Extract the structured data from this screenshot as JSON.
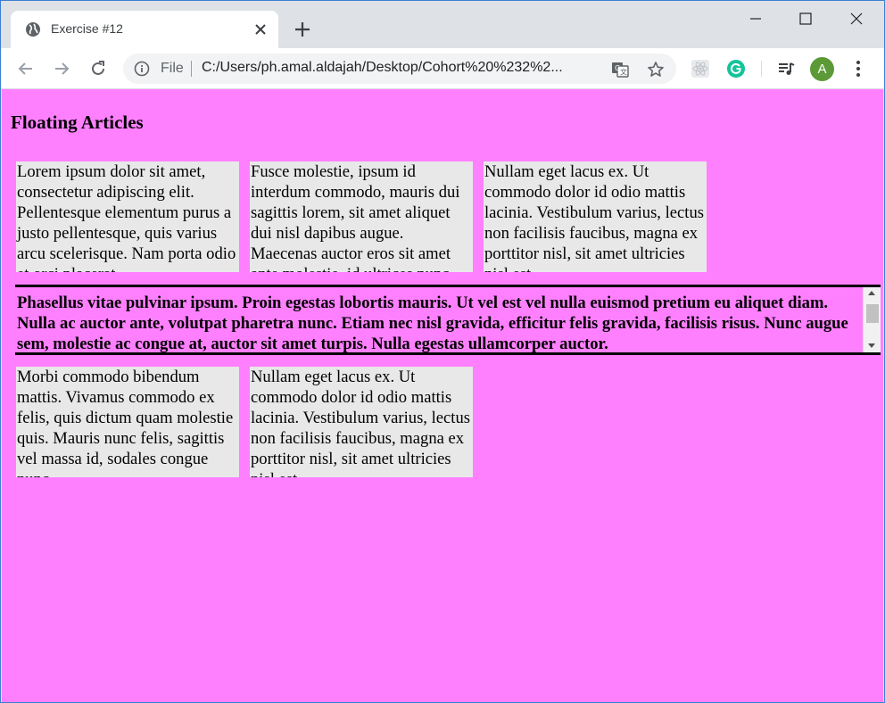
{
  "browser": {
    "tab_title": "Exercise #12",
    "omnibox": {
      "scheme_label": "File",
      "url": "C:/Users/ph.amal.aldajah/Desktop/Cohort%20%232%2..."
    },
    "profile_initial": "A",
    "icons": {
      "favicon": "globe-icon",
      "close": "close-icon",
      "new_tab": "plus-icon",
      "back": "back-arrow-icon",
      "forward": "forward-arrow-icon",
      "reload": "reload-icon",
      "info": "info-icon",
      "translate": "translate-icon",
      "bookmark": "star-icon",
      "extension1": "react-devtools-icon",
      "extension2": "grammarly-icon",
      "media": "media-control-icon",
      "menu": "kebab-menu-icon"
    },
    "colors": {
      "tabstrip": "#dee1e6",
      "avatar": "#5b9a36",
      "grammarly": "#15c39a"
    }
  },
  "page": {
    "title": "Floating Articles",
    "background": "#ff80ff",
    "articles_row1": [
      "Lorem ipsum dolor sit amet, consectetur adipiscing elit. Pellentesque elementum purus a justo pellentesque, quis varius arcu scelerisque. Nam porta odio et orci placerat",
      "Fusce molestie, ipsum id interdum commodo, mauris dui sagittis lorem, sit amet aliquet dui nisl dapibus augue. Maecenas auctor eros sit amet ante molestie, id ultrices nunc",
      "Nullam eget lacus ex. Ut commodo dolor id odio mattis lacinia. Vestibulum varius, lectus non facilisis faucibus, magna ex porttitor nisl, sit amet ultricies nisl est"
    ],
    "feature_text": "Phasellus vitae pulvinar ipsum. Proin egestas lobortis mauris. Ut vel est vel nulla euismod pretium eu aliquet diam. Nulla ac auctor ante, volutpat pharetra nunc. Etiam nec nisl gravida, efficitur felis gravida, facilisis risus. Nunc augue sem, molestie ac congue at, auctor sit amet turpis. Nulla egestas ullamcorper auctor.",
    "articles_row2": [
      "Morbi commodo bibendum mattis. Vivamus commodo ex felis, quis dictum quam molestie quis. Mauris nunc felis, sagittis vel massa id, sodales congue nunc",
      "Nullam eget lacus ex. Ut commodo dolor id odio mattis lacinia. Vestibulum varius, lectus non facilisis faucibus, magna ex porttitor nisl, sit amet ultricies nisl est"
    ]
  }
}
